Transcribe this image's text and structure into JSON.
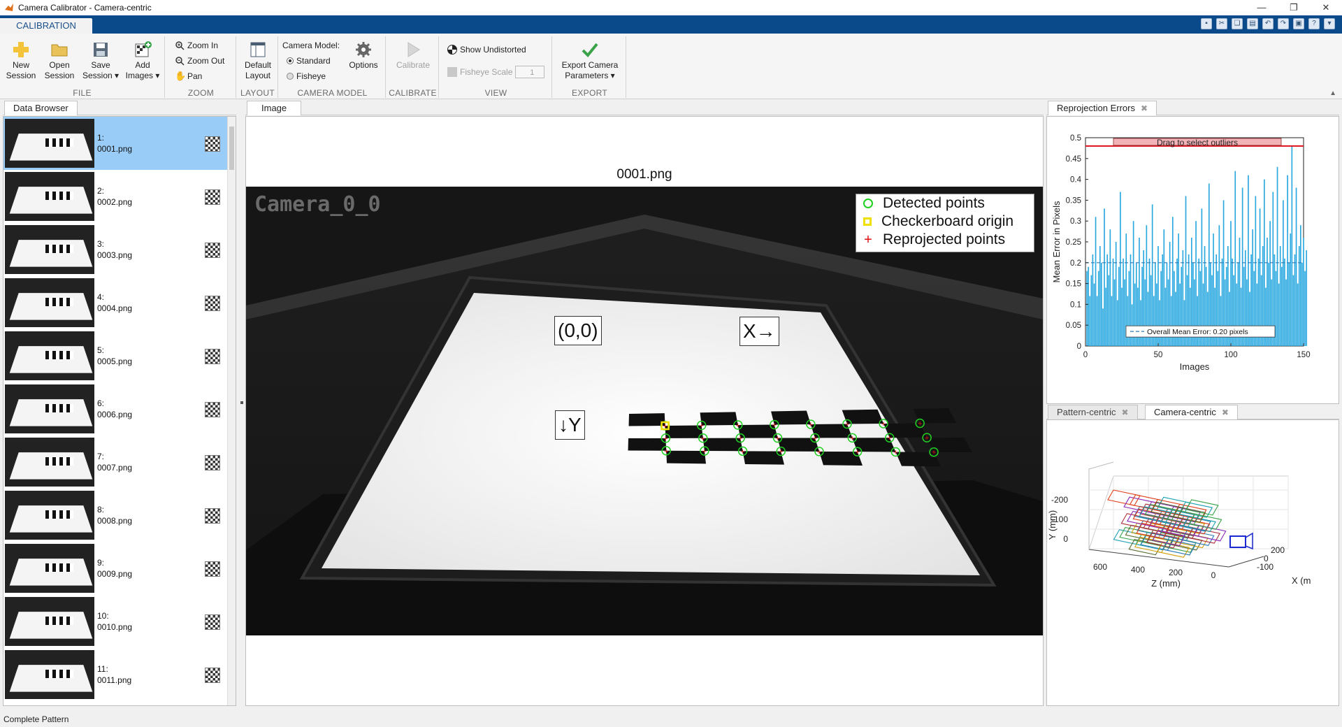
{
  "window": {
    "title": "Camera Calibrator - Camera-centric"
  },
  "ribbon": {
    "tab": "CALIBRATION",
    "file": {
      "group": "FILE",
      "new_session": [
        "New",
        "Session"
      ],
      "open_session": [
        "Open",
        "Session"
      ],
      "save_session": [
        "Save",
        "Session ▾"
      ],
      "add_images": [
        "Add",
        "Images ▾"
      ]
    },
    "zoom": {
      "group": "ZOOM",
      "zoom_in": "Zoom In",
      "zoom_out": "Zoom Out",
      "pan": "Pan"
    },
    "layout": {
      "group": "LAYOUT",
      "default_layout": [
        "Default",
        "Layout"
      ]
    },
    "camera_model": {
      "group": "CAMERA MODEL",
      "label": "Camera Model:",
      "standard": "Standard",
      "fisheye": "Fisheye",
      "options": "Options"
    },
    "calibrate": {
      "group": "CALIBRATE",
      "calibrate": "Calibrate"
    },
    "view": {
      "group": "VIEW",
      "show_undistorted": "Show Undistorted",
      "fisheye_scale": "Fisheye Scale",
      "fisheye_scale_value": "1"
    },
    "export": {
      "group": "EXPORT",
      "export": [
        "Export Camera",
        "Parameters ▾"
      ]
    }
  },
  "data_browser": {
    "tab": "Data Browser",
    "items": [
      {
        "num": "1:",
        "file": "0001.png"
      },
      {
        "num": "2:",
        "file": "0002.png"
      },
      {
        "num": "3:",
        "file": "0003.png"
      },
      {
        "num": "4:",
        "file": "0004.png"
      },
      {
        "num": "5:",
        "file": "0005.png"
      },
      {
        "num": "6:",
        "file": "0006.png"
      },
      {
        "num": "7:",
        "file": "0007.png"
      },
      {
        "num": "8:",
        "file": "0008.png"
      },
      {
        "num": "9:",
        "file": "0009.png"
      },
      {
        "num": "10:",
        "file": "0010.png"
      },
      {
        "num": "11:",
        "file": "0011.png"
      }
    ]
  },
  "image_panel": {
    "tab": "Image",
    "title": "0001.png",
    "camera_label": "Camera_0_0",
    "legend": [
      "Detected points",
      "Checkerboard origin",
      "Reprojected points"
    ],
    "origin_label": "(0,0)",
    "x_label": "X→",
    "y_label": "↓Y"
  },
  "reprojection": {
    "tab": "Reprojection Errors",
    "select_label": "Drag to select outliers",
    "mean_label": "Overall Mean Error: 0.20 pixels",
    "colors": {
      "bar": "#29a8e0",
      "threshold": "#e0101a"
    }
  },
  "chart_data": {
    "type": "bar",
    "xlabel": "Images",
    "ylabel": "Mean Error in Pixels",
    "xlim": [
      0,
      150
    ],
    "ylim": [
      0,
      0.5
    ],
    "xticks": [
      0,
      50,
      100,
      150
    ],
    "yticks": [
      0,
      0.05,
      0.1,
      0.15,
      0.2,
      0.25,
      0.3,
      0.35,
      0.4,
      0.45,
      0.5
    ],
    "mean_error": 0.2,
    "threshold": 0.48,
    "values": [
      0.18,
      0.19,
      0.12,
      0.17,
      0.22,
      0.15,
      0.31,
      0.12,
      0.18,
      0.24,
      0.2,
      0.09,
      0.33,
      0.14,
      0.22,
      0.17,
      0.28,
      0.12,
      0.21,
      0.16,
      0.25,
      0.11,
      0.19,
      0.37,
      0.14,
      0.21,
      0.16,
      0.27,
      0.12,
      0.18,
      0.22,
      0.1,
      0.3,
      0.15,
      0.2,
      0.14,
      0.26,
      0.11,
      0.19,
      0.23,
      0.16,
      0.29,
      0.13,
      0.21,
      0.17,
      0.34,
      0.12,
      0.2,
      0.15,
      0.24,
      0.11,
      0.18,
      0.22,
      0.28,
      0.14,
      0.2,
      0.16,
      0.25,
      0.12,
      0.31,
      0.18,
      0.13,
      0.21,
      0.27,
      0.15,
      0.19,
      0.23,
      0.11,
      0.36,
      0.17,
      0.22,
      0.14,
      0.26,
      0.2,
      0.16,
      0.3,
      0.12,
      0.21,
      0.18,
      0.33,
      0.15,
      0.24,
      0.19,
      0.13,
      0.39,
      0.2,
      0.17,
      0.27,
      0.14,
      0.22,
      0.18,
      0.29,
      0.12,
      0.21,
      0.35,
      0.16,
      0.19,
      0.24,
      0.13,
      0.3,
      0.21,
      0.17,
      0.42,
      0.15,
      0.2,
      0.26,
      0.14,
      0.38,
      0.19,
      0.23,
      0.16,
      0.41,
      0.13,
      0.22,
      0.28,
      0.18,
      0.36,
      0.15,
      0.21,
      0.33,
      0.17,
      0.24,
      0.4,
      0.14,
      0.26,
      0.2,
      0.3,
      0.16,
      0.37,
      0.22,
      0.18,
      0.43,
      0.15,
      0.24,
      0.19,
      0.35,
      0.21,
      0.16,
      0.41,
      0.2,
      0.27,
      0.48,
      0.17,
      0.22,
      0.38,
      0.15,
      0.24,
      0.29,
      0.2,
      0.26,
      0.18,
      0.23
    ]
  },
  "camera_view": {
    "tabs": [
      "Pattern-centric",
      "Camera-centric"
    ],
    "ylabel": "Y (mm)",
    "zlabel": "Z (mm)",
    "xlabel": "X (m",
    "yticks": [
      "-200",
      "-100",
      "0"
    ],
    "zticks": [
      "600",
      "400",
      "200",
      "0"
    ],
    "xticks": [
      "200",
      "0",
      "-100"
    ]
  },
  "status": {
    "text": "Complete Pattern"
  }
}
